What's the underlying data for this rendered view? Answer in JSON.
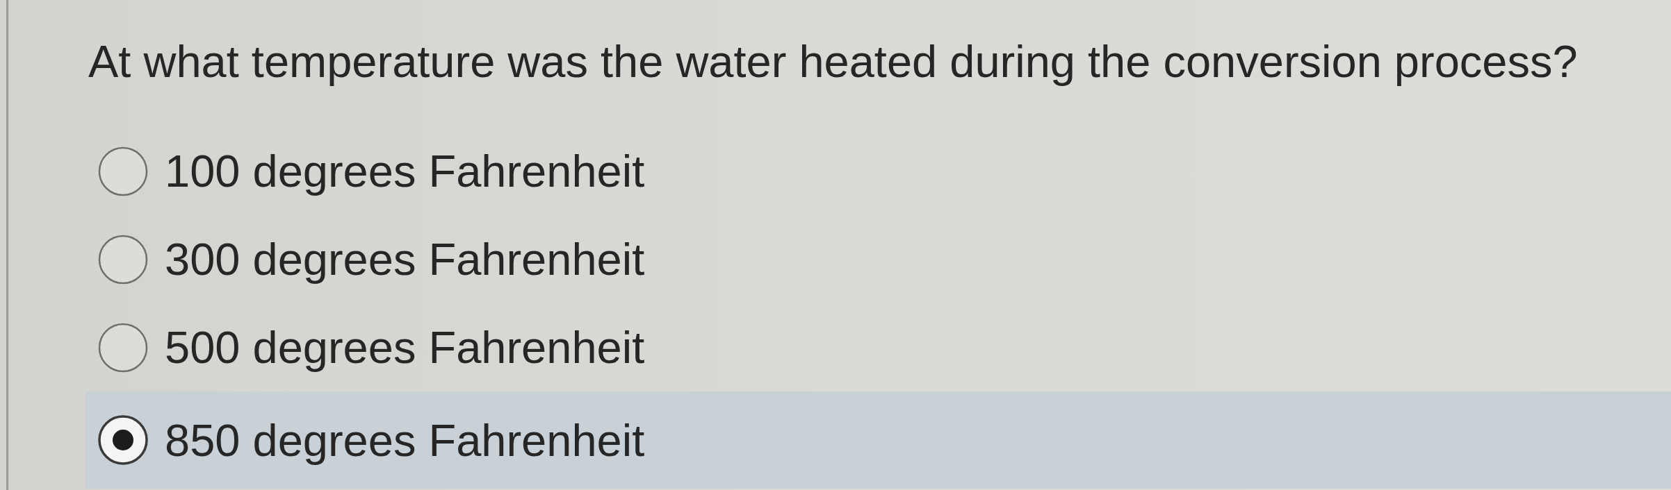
{
  "question": "At what temperature was the water heated during the conversion process?",
  "options": [
    {
      "label": "100 degrees Fahrenheit",
      "selected": false
    },
    {
      "label": "300 degrees Fahrenheit",
      "selected": false
    },
    {
      "label": "500 degrees Fahrenheit",
      "selected": false
    },
    {
      "label": "850 degrees Fahrenheit",
      "selected": true
    }
  ]
}
